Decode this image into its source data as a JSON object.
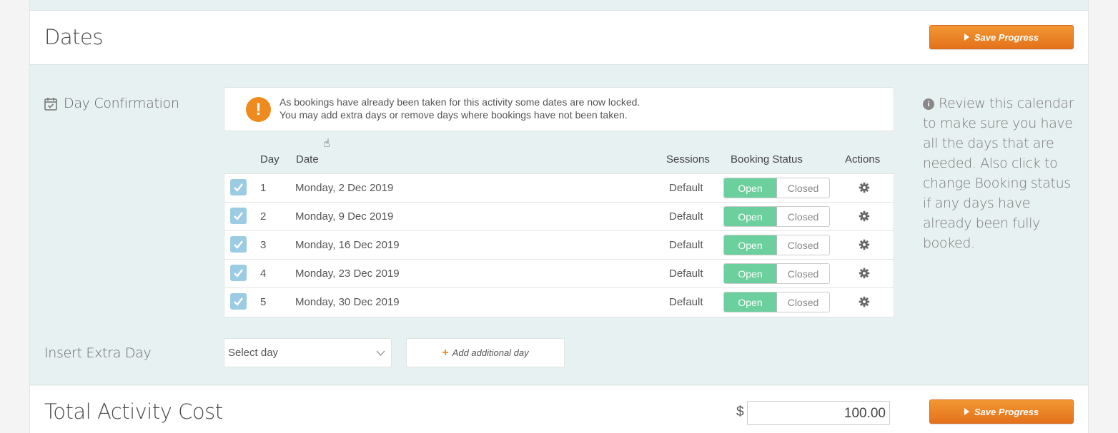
{
  "dates_section": {
    "title": "Dates",
    "save_label": "Save Progress"
  },
  "day_confirmation": {
    "label": "Day Confirmation",
    "notice_line1": "As bookings have already been taken for this activity some dates are now locked.",
    "notice_line2": "You may add extra days or remove days where bookings have not been taken."
  },
  "table": {
    "headers": {
      "day": "Day",
      "date": "Date",
      "sessions": "Sessions",
      "booking_status": "Booking Status",
      "actions": "Actions"
    },
    "rows": [
      {
        "day": "1",
        "date": "Monday, 2 Dec 2019",
        "sessions": "Default",
        "status": "Open",
        "checked": true
      },
      {
        "day": "2",
        "date": "Monday, 9 Dec 2019",
        "sessions": "Default",
        "status": "Open",
        "checked": true
      },
      {
        "day": "3",
        "date": "Monday, 16 Dec 2019",
        "sessions": "Default",
        "status": "Open",
        "checked": true
      },
      {
        "day": "4",
        "date": "Monday, 23 Dec 2019",
        "sessions": "Default",
        "status": "Open",
        "checked": true
      },
      {
        "day": "5",
        "date": "Monday, 30 Dec 2019",
        "sessions": "Default",
        "status": "Open",
        "checked": true
      }
    ],
    "toggle_open": "Open",
    "toggle_closed": "Closed"
  },
  "insert_extra_day": {
    "label": "Insert Extra Day",
    "select_value": "Select day",
    "add_label": "Add additional day"
  },
  "help_text": "Review this calendar to make sure you have all the days that are needed. Also click to change Booking status if any days have already been fully booked.",
  "total_cost": {
    "title": "Total Activity Cost",
    "currency": "$",
    "value": "100.00",
    "save_label": "Save Progress"
  },
  "colors": {
    "accent_orange": "#ef8a1e",
    "open_green": "#6ccf9e",
    "checkbox_blue": "#9ccbe4",
    "section_bg": "#e8f1f1"
  }
}
